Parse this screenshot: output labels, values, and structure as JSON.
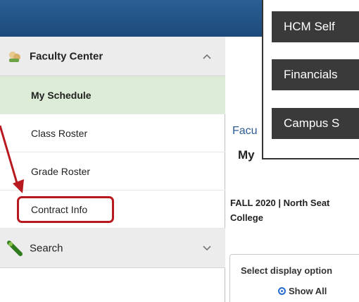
{
  "sidebar": {
    "faculty_center": {
      "label": "Faculty Center",
      "icon": "faculty-center-icon",
      "chevron": "chevron-up-icon"
    },
    "items": [
      {
        "label": "My Schedule",
        "active": true
      },
      {
        "label": "Class Roster"
      },
      {
        "label": "Grade Roster"
      },
      {
        "label": "Contract Info",
        "highlighted": true
      }
    ],
    "search": {
      "label": "Search",
      "icon": "search-icon",
      "chevron": "chevron-down-icon"
    }
  },
  "content": {
    "heading_partial": "Facu",
    "subheading_partial": "My",
    "term_line1": "FALL 2020 | North Seat",
    "term_line2": "College",
    "display_options_label": "Select display option",
    "show_all_label": "Show All"
  },
  "zoom_panel": {
    "buttons": [
      "HCM Self",
      "Financials",
      "Campus S"
    ]
  },
  "colors": {
    "top_bar": "#1d4a7a",
    "active_item_bg": "#dcecd6",
    "highlight": "#b8191f",
    "link_blue": "#2d5c93",
    "dark_button": "#3a3a3a"
  }
}
